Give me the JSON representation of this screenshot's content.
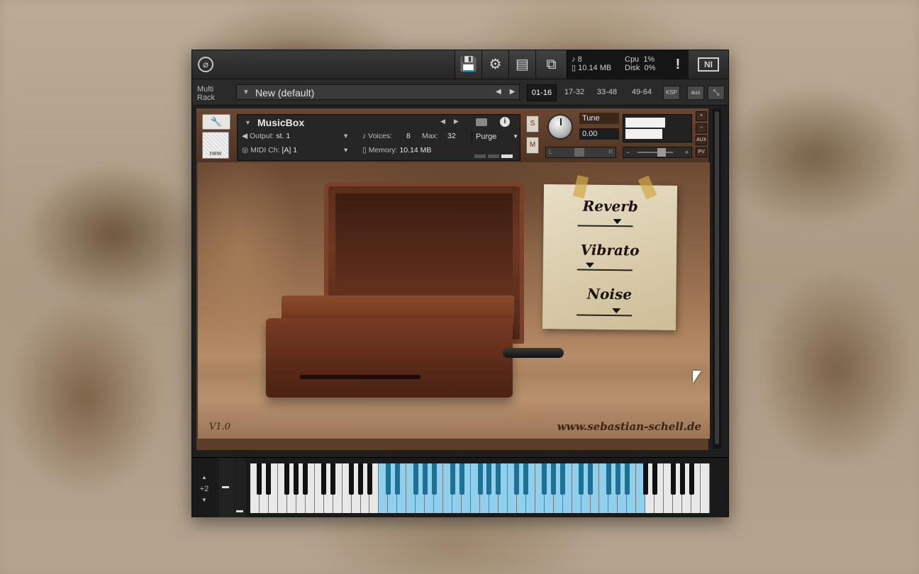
{
  "toolbar": {
    "stats_voices": "8",
    "stats_memory": "10.14 MB",
    "cpu_label": "Cpu",
    "cpu_value": "1%",
    "disk_label": "Disk",
    "disk_value": "0%",
    "warning": "!",
    "brand": "NI"
  },
  "rack": {
    "label_line1": "Multi",
    "label_line2": "Rack",
    "name": "New (default)",
    "pages": [
      "01-16",
      "17-32",
      "33-48",
      "49-64"
    ],
    "active_page": "01-16",
    "ksp": "KSP",
    "aux": "aux"
  },
  "instrument": {
    "name": "MusicBox",
    "new_label": "new",
    "output_label": "Output:",
    "output_value": "st. 1",
    "midi_label": "MIDI Ch:",
    "midi_value": "[A]  1",
    "voices_label": "Voices:",
    "voices_value": "8",
    "max_label": "Max:",
    "max_value": "32",
    "memory_label": "Memory:",
    "memory_value": "10.14 MB",
    "purge": "Purge",
    "solo": "S",
    "mute": "M",
    "tune_label": "Tune",
    "tune_value": "0.00",
    "pan_left": "L",
    "pan_right": "R",
    "vol_minus": "−",
    "vol_plus": "+",
    "side_close": "×",
    "side_min": "−",
    "side_aux": "AUX",
    "side_pv": "PV"
  },
  "gui": {
    "effects": [
      "Reverb",
      "Vibrato",
      "Noise"
    ],
    "version": "V1.0",
    "website": "www.sebastian-schell.de"
  },
  "keyboard": {
    "octave_up": "▲",
    "octave_value": "+2",
    "octave_down": "▼"
  },
  "colors": {
    "key_highlight": "#8ed0ee",
    "panel_bg": "#262626"
  }
}
